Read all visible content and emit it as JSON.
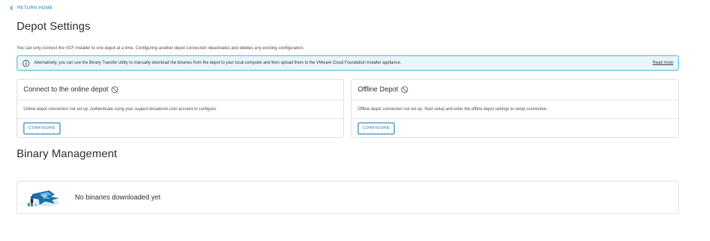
{
  "nav": {
    "back_label": "RETURN HOME"
  },
  "page": {
    "title": "Depot Settings",
    "intro": "You can only connect the VCF Installer to one depot at a time. Configuring another depot connection deactivates and deletes any existing configuration."
  },
  "alert": {
    "text": "Alternatively, you can use the Binary Transfer utility to manually download the binaries from the depot to your local computer and then upload them to the VMware Cloud Foundation Installer appliance.",
    "link_label": "Read more",
    "icon": "info-icon"
  },
  "online_depot": {
    "title": "Connect to the online depot",
    "status_icon": "ban-icon",
    "description": "Online depot connection not set up. Authenticate using your support.broadcom.com account to configure.",
    "button_label": "CONFIGURE"
  },
  "offline_depot": {
    "title": "Offline Depot",
    "status_icon": "ban-icon",
    "description": "Offline depot connection not set up. Start setup and enter the offline depot settings to setup connection.",
    "button_label": "CONFIGURE"
  },
  "binary_management": {
    "title": "Binary Management",
    "empty_message": "No binaries downloaded yet",
    "illustration": "empty-state-illustration"
  },
  "colors": {
    "link": "#0072a3",
    "alert_bg": "#e6f7fb",
    "alert_border": "#49afd9",
    "card_border": "#dddddd"
  }
}
